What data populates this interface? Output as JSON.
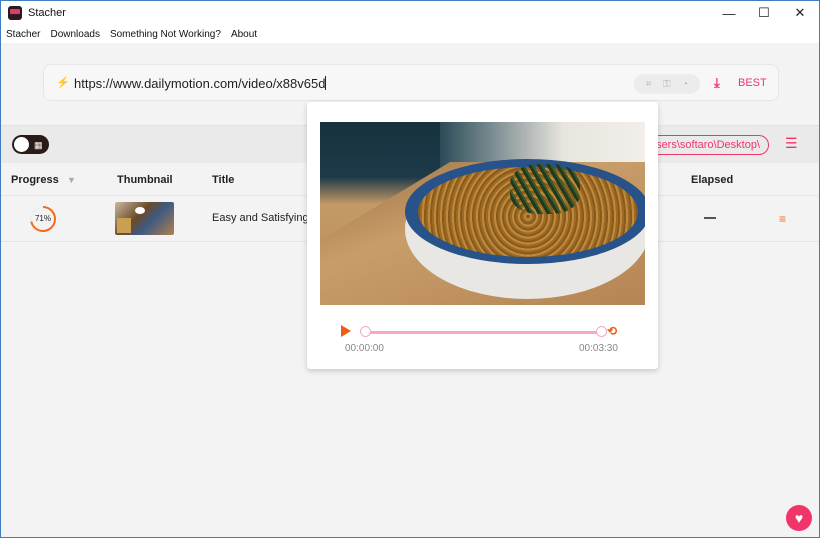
{
  "window": {
    "title": "Stacher",
    "controls": {
      "minimize": "—",
      "maximize": "☐",
      "close": "✕"
    }
  },
  "menu": [
    "Stacher",
    "Downloads",
    "Something Not Working?",
    "About"
  ],
  "urlbar": {
    "icon": "bolt-icon",
    "value": "https://www.dailymotion.com/video/x88v65d",
    "tools": {
      "crop": "⌗",
      "key": "⚿",
      "cookie": "◔"
    },
    "download_icon": "⤓",
    "quality": "BEST"
  },
  "toolbar": {
    "view_toggle_icon": "▦",
    "output_path": "C:\\Users\\softaro\\Desktop\\",
    "settings_icon": "☰"
  },
  "table": {
    "columns": [
      "Progress",
      "Thumbnail",
      "Title",
      "Elapsed"
    ],
    "filter_icon": "▼",
    "rows": [
      {
        "progress_pct": 71,
        "progress_label": "71%",
        "title": "Easy and Satisfying",
        "elapsed": "—",
        "menu_icon": "≡"
      }
    ]
  },
  "preview": {
    "current_time": "00:00:00",
    "duration": "00:03:30",
    "start_fraction": 0,
    "end_fraction": 1,
    "loop_icon": "⟲"
  },
  "colors": {
    "accent": "#f0356a",
    "orange": "#f26b1d",
    "track": "#f7a9bb"
  },
  "heart_icon": "♥"
}
